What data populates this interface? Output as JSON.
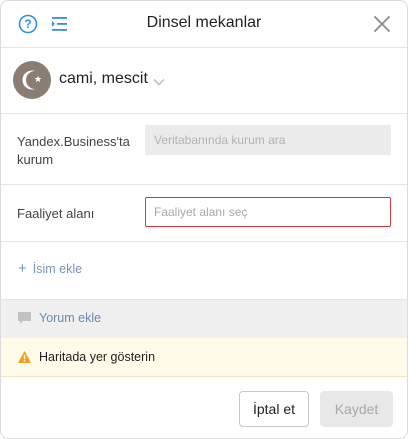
{
  "dialog": {
    "title": "Dinsel mekanlar"
  },
  "category": {
    "name": "cami, mescit"
  },
  "form": {
    "business_label": "Yandex.Business'ta kurum",
    "business_placeholder": "Veritabanında kurum ara",
    "activity_label": "Faaliyet alanı",
    "activity_placeholder": "Faaliyet alanı seç"
  },
  "actions": {
    "add_name": "İsim ekle",
    "add_comment": "Yorum ekle",
    "show_on_map": "Haritada yer gösterin",
    "cancel": "İptal et",
    "save": "Kaydet"
  },
  "colors": {
    "accent_link": "#7795b8",
    "error_border": "#d33b3b",
    "warning_icon": "#f0a020",
    "warning_bg": "#fffbe8"
  },
  "icons": {
    "help": "help-circle-icon",
    "outline": "outline-list-icon",
    "close": "close-icon",
    "category": "crescent-star-icon",
    "chevron": "chevron-down-icon",
    "comment": "speech-bubble-icon",
    "warning": "warning-triangle-icon"
  }
}
